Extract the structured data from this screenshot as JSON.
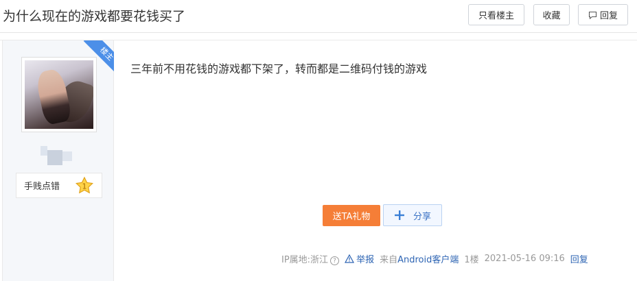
{
  "header": {
    "title": "为什么现在的游戏都要花钱买了",
    "only_op_label": "只看楼主",
    "favorite_label": "收藏",
    "reply_label": "回复"
  },
  "author": {
    "badge_label": "手贱点错",
    "level": "1",
    "op_tag": "楼主"
  },
  "post": {
    "content": "三年前不用花钱的游戏都下架了，转而都是二维码付钱的游戏",
    "gift_label": "送TA礼物",
    "share_label": "分享"
  },
  "meta": {
    "ip_location": "IP属地:浙江",
    "help_icon": "?",
    "report_label": "举报",
    "from_prefix": "来自",
    "from_client": "Android客户端",
    "floor": "1楼",
    "timestamp": "2021-05-16 09:16",
    "reply_label": "回复"
  },
  "colors": {
    "gift": "#f57e37",
    "link": "#2d64b3",
    "ribbon": "#4c8fe8"
  }
}
